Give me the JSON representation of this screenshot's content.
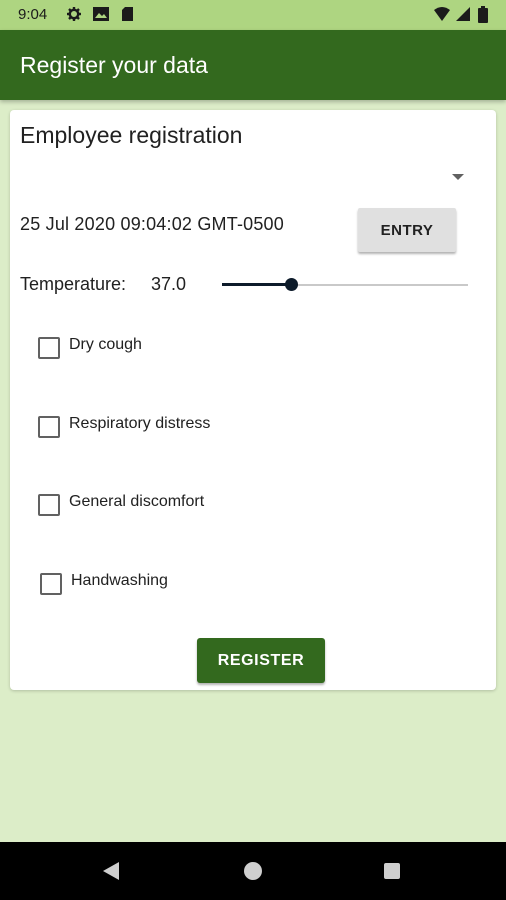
{
  "status_bar": {
    "time": "9:04",
    "icons": [
      "gear-icon",
      "image-icon",
      "sd-card-icon",
      "wifi-icon",
      "signal-icon",
      "battery-icon"
    ]
  },
  "app_bar": {
    "title": "Register your data",
    "color": "#33691e"
  },
  "form": {
    "title": "Employee registration",
    "dropdown_value": "",
    "datetime": "25 Jul 2020 09:04:02 GMT-0500",
    "entry_button_label": "ENTRY",
    "temperature_label": "Temperature:",
    "temperature_value": "37.0",
    "temperature_slider_fraction": 0.28,
    "checkboxes": [
      {
        "label": "Dry cough",
        "checked": false
      },
      {
        "label": "Respiratory distress",
        "checked": false
      },
      {
        "label": "General discomfort",
        "checked": false
      },
      {
        "label": "Handwashing",
        "checked": false
      }
    ],
    "register_button_label": "REGISTER"
  },
  "colors": {
    "status_bar": "#aed581",
    "background": "#dcedc8",
    "accent": "#33691e",
    "slider": "#0d1b2a"
  },
  "nav_bar": {
    "icons": [
      "back-icon",
      "home-icon",
      "recents-icon"
    ]
  }
}
